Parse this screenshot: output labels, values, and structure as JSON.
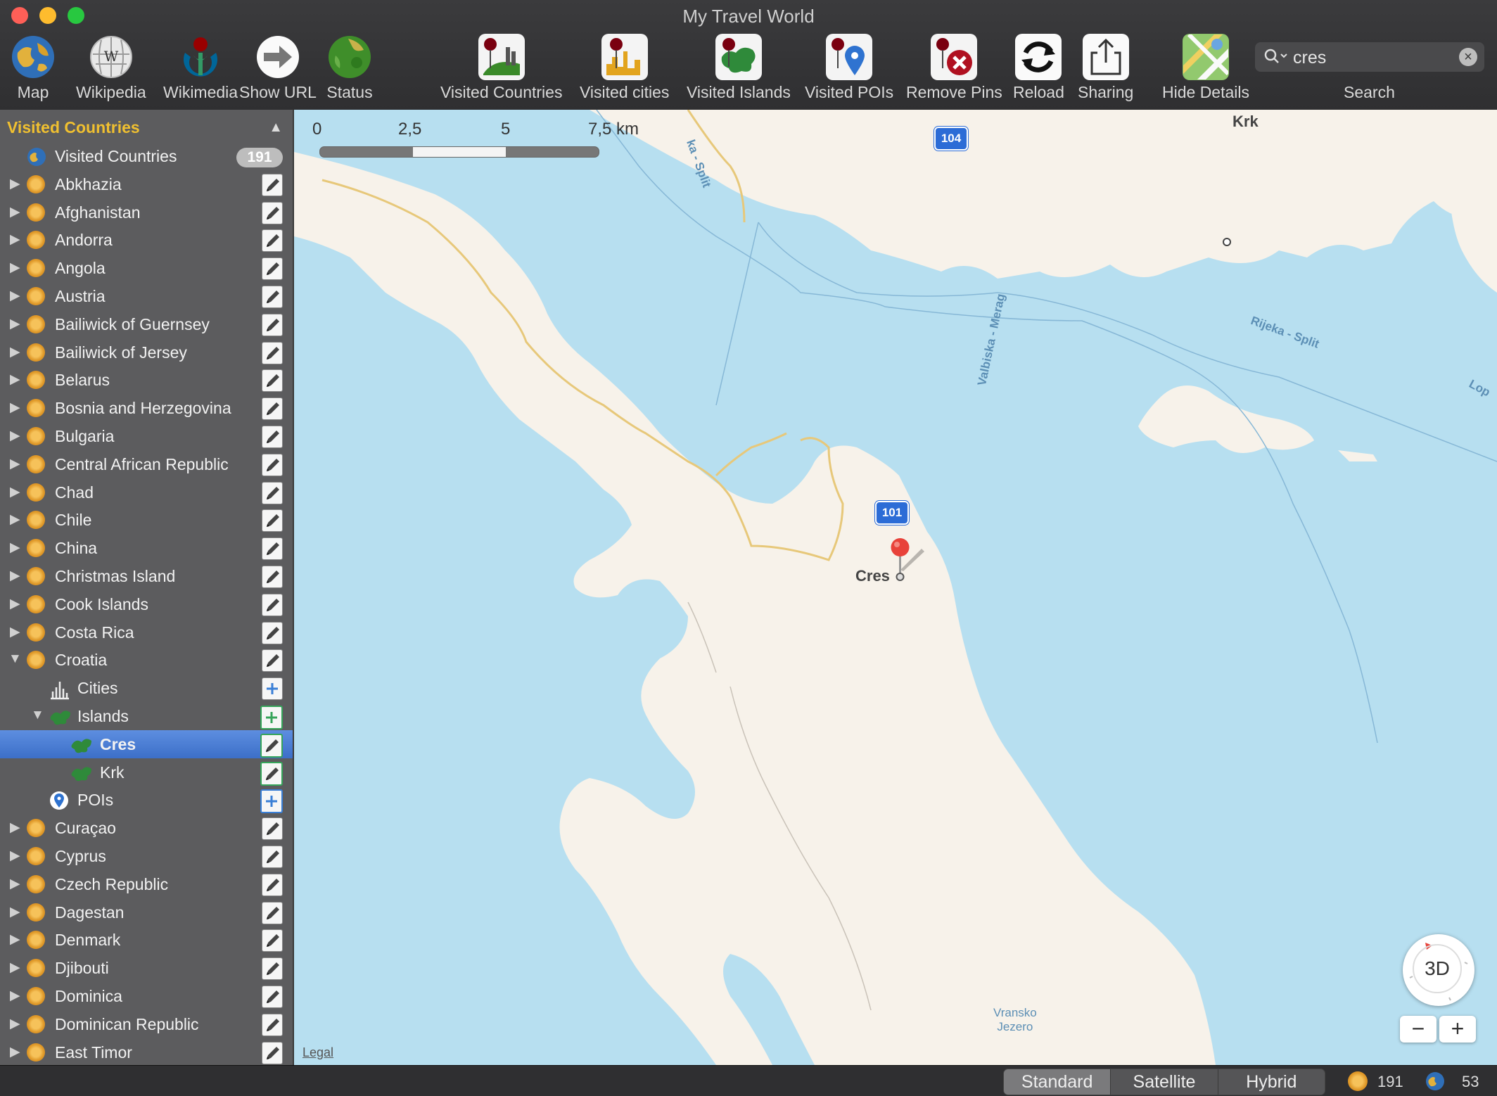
{
  "window": {
    "title": "My Travel World"
  },
  "toolbar": {
    "items": [
      {
        "label": "Map",
        "icon": "globe-icon"
      },
      {
        "label": "Wikipedia",
        "icon": "wikipedia-globe-icon"
      },
      {
        "label": "Wikimedia",
        "icon": "wikimedia-icon"
      },
      {
        "label": "Show URL",
        "icon": "arrow-right-icon"
      },
      {
        "label": "Status",
        "icon": "earth-status-icon"
      },
      {
        "label": "Visited Countries",
        "icon": "pin-country-icon"
      },
      {
        "label": "Visited cities",
        "icon": "pin-city-icon"
      },
      {
        "label": "Visited Islands",
        "icon": "pin-island-icon"
      },
      {
        "label": "Visited POIs",
        "icon": "pin-poi-icon"
      },
      {
        "label": "Remove Pins",
        "icon": "pin-remove-icon"
      },
      {
        "label": "Reload",
        "icon": "reload-icon"
      },
      {
        "label": "Sharing",
        "icon": "share-icon"
      },
      {
        "label": "Hide Details",
        "icon": "map-details-icon"
      }
    ],
    "search": {
      "value": "cres",
      "label": "Search"
    }
  },
  "sidebar": {
    "header": "Visited Countries",
    "summary": {
      "label": "Visited Countries",
      "count": "191"
    },
    "countries_before": [
      "Abkhazia",
      "Afghanistan",
      "Andorra",
      "Angola",
      "Austria",
      "Bailiwick of Guernsey",
      "Bailiwick of Jersey",
      "Belarus",
      "Bosnia and Herzegovina",
      "Bulgaria",
      "Central African Republic",
      "Chad",
      "Chile",
      "China",
      "Christmas Island",
      "Cook Islands",
      "Costa Rica"
    ],
    "expanded": {
      "country": "Croatia",
      "cities": "Cities",
      "islands": "Islands",
      "island_items": [
        "Cres",
        "Krk"
      ],
      "selected": "Cres",
      "pois": "POIs"
    },
    "countries_after": [
      "Curaçao",
      "Cyprus",
      "Czech Republic",
      "Dagestan",
      "Denmark",
      "Djibouti",
      "Dominica",
      "Dominican Republic",
      "East Timor"
    ]
  },
  "map": {
    "scale": {
      "labels": [
        "0",
        "2,5",
        "5",
        "7,5 km"
      ]
    },
    "roads": [
      "104",
      "101"
    ],
    "places": {
      "krk": "Krk",
      "cres": "Cres"
    },
    "ferries": {
      "f1": "ka - Split",
      "f2": "Valbiska - Merag",
      "f3": "Rijeka - Split",
      "f4": "Lop"
    },
    "lake": "Vransko\nJezero",
    "legal": "Legal",
    "compass": "3D",
    "zoom_out": "−",
    "zoom_in": "+"
  },
  "statusbar": {
    "modes": [
      "Standard",
      "Satellite",
      "Hybrid"
    ],
    "active_mode": "Standard",
    "countries_count": "191",
    "other_count": "53"
  }
}
